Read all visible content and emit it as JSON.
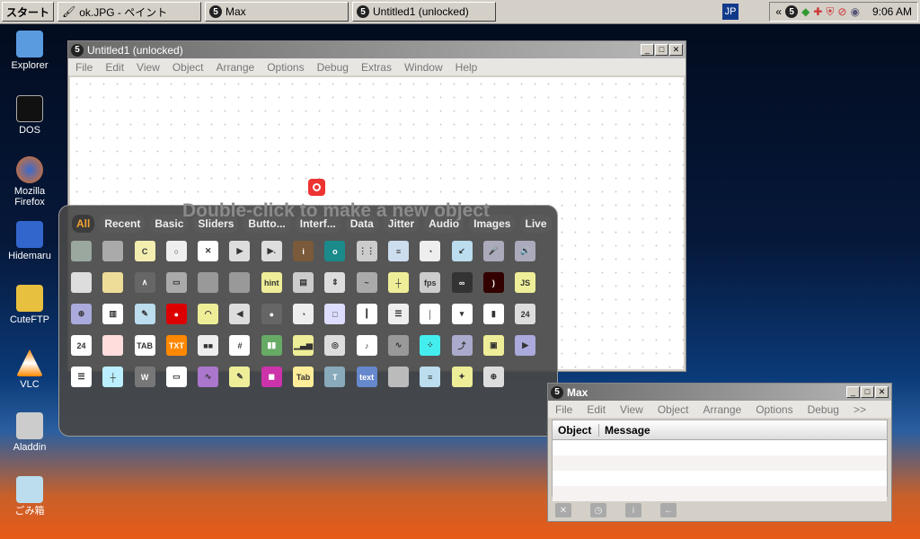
{
  "taskbar": {
    "start": "スタート",
    "tasks": [
      "ok.JPG - ペイント",
      "Max",
      "Untitled1 (unlocked)"
    ],
    "lang": "JP",
    "tray_expand": "«",
    "clock": "9:06 AM"
  },
  "desktop": [
    "Explorer",
    "DOS",
    "Mozilla Firefox",
    "Hidemaru",
    "CuteFTP",
    "VLC",
    "Aladdin",
    "ごみ箱"
  ],
  "patcher": {
    "title": "Untitled1 (unlocked)",
    "menu": [
      "File",
      "Edit",
      "View",
      "Object",
      "Arrange",
      "Options",
      "Debug",
      "Extras",
      "Window",
      "Help"
    ],
    "hint": "Double-click to make a new object"
  },
  "palette": {
    "tabs": [
      "All",
      "Recent",
      "Basic",
      "Sliders",
      "Butto...",
      "Interf...",
      "Data",
      "Jitter",
      "Audio",
      "Images",
      "Live"
    ],
    "items": [
      [
        "bpatcher",
        "#9aa8a0",
        ""
      ],
      [
        "panel",
        "#aaa",
        ""
      ],
      [
        "comment",
        "#f3eeb0",
        "C"
      ],
      [
        "toggle-circle",
        "#eee",
        "○"
      ],
      [
        "toggle",
        "#fff",
        "✕"
      ],
      [
        "button-play",
        "#ddd",
        "▶"
      ],
      [
        "message",
        "#ddd",
        "▶."
      ],
      [
        "info",
        "#7a5a3a",
        "i"
      ],
      [
        "outlet",
        "#1a8a8a",
        "o"
      ],
      [
        "matrixctrl",
        "#ccc",
        "⋮⋮"
      ],
      [
        "inlet-patch",
        "#cde",
        "≡"
      ],
      [
        "dial",
        "#eee",
        "◔"
      ],
      [
        "swatch-arrow",
        "#bde",
        "↙"
      ],
      [
        "mic",
        "#aab",
        "🎤"
      ],
      [
        "speaker",
        "#aab",
        "🔊"
      ],
      [
        "filtergraph",
        "#ddd",
        ""
      ],
      [
        "fpic",
        "#ed9",
        ""
      ],
      [
        "function",
        "#666",
        "∧"
      ],
      [
        "textbutton",
        "#aaa",
        "▭"
      ],
      [
        "patcher-small",
        "#999",
        ""
      ],
      [
        "patcher-open",
        "#999",
        ""
      ],
      [
        "hint",
        "#ee9",
        "hint"
      ],
      [
        "movie",
        "#ccc",
        "▤"
      ],
      [
        "number-stepper",
        "#ddd",
        "⇕"
      ],
      [
        "scope",
        "#aaa",
        "~"
      ],
      [
        "grid-dot",
        "#ee9",
        "┼"
      ],
      [
        "fps",
        "#ccc",
        "fps"
      ],
      [
        "jit-glasses",
        "#333",
        "∞"
      ],
      [
        "spectroscope",
        "#300",
        ")"
      ],
      [
        "js",
        "#ee9",
        "JS"
      ],
      [
        "globe",
        "#aad",
        "⊕"
      ],
      [
        "kslider",
        "#fff",
        "▥"
      ],
      [
        "pencil",
        "#bde",
        "✎"
      ],
      [
        "record",
        "#d00",
        "●"
      ],
      [
        "meter",
        "#ee9",
        "◠"
      ],
      [
        "gain-triangle",
        "#ddd",
        "◀"
      ],
      [
        "led",
        "#666",
        "●"
      ],
      [
        "dial-live",
        "#eee",
        "◔"
      ],
      [
        "multislider",
        "#ddf",
        "□"
      ],
      [
        "slider-v",
        "#fff",
        "┃"
      ],
      [
        "live-grid",
        "#eee",
        "☰"
      ],
      [
        "live-tab",
        "#fff",
        "│"
      ],
      [
        "umenu",
        "#fff",
        "▾"
      ],
      [
        "gain-meter",
        "#fff",
        "▮"
      ],
      [
        "live-number",
        "#ddd",
        "24"
      ],
      [
        "live-slider",
        "#fff",
        "24"
      ],
      [
        "table",
        "#fdd",
        ""
      ],
      [
        "tab-object",
        "#fff",
        "TAB"
      ],
      [
        "textedit",
        "#f80",
        "TXT"
      ],
      [
        "radiogroup",
        "#eee",
        "■■"
      ],
      [
        "nodes-grid",
        "#fff",
        "#"
      ],
      [
        "levels",
        "#6a6",
        "▮▮"
      ],
      [
        "histogram",
        "#ee9",
        "▁▃▅"
      ],
      [
        "nodes",
        "#ddd",
        "◎"
      ],
      [
        "score",
        "#fff",
        "♪"
      ],
      [
        "waveform",
        "#999",
        "∿"
      ],
      [
        "pictslider",
        "#4ee",
        "⁘"
      ],
      [
        "plot",
        "#aac",
        "⤴"
      ],
      [
        "live-text",
        "#ee9",
        "▣"
      ],
      [
        "play",
        "#aad",
        "▶"
      ],
      [
        "chooser",
        "#fff",
        "☰"
      ],
      [
        "jsui",
        "#bef",
        "┼"
      ],
      [
        "pictctrl",
        "#777",
        "W"
      ],
      [
        "ubutton",
        "#fff",
        "▭"
      ],
      [
        "waveform-purple",
        "#a7c",
        "∿"
      ],
      [
        "colorpicker",
        "#ee9",
        "✎"
      ],
      [
        "swatch",
        "#c3a",
        "◼"
      ],
      [
        "tab",
        "#fe9",
        "Tab"
      ],
      [
        "textbutton-t",
        "#8ab",
        "T"
      ],
      [
        "text",
        "#68c",
        "text"
      ],
      [
        "hatched",
        "#bbb",
        ""
      ],
      [
        "dropfile",
        "#bde",
        "≡"
      ],
      [
        "audio-wave",
        "#ee9",
        "✦"
      ],
      [
        "crosshair",
        "#ddd",
        "⊕"
      ]
    ]
  },
  "console": {
    "title": "Max",
    "menu": [
      "File",
      "Edit",
      "View",
      "Object",
      "Arrange",
      "Options",
      "Debug",
      ">>"
    ],
    "columns": [
      "Object",
      "Message"
    ],
    "buttons": [
      "✕",
      "◷",
      "i",
      "←"
    ]
  }
}
